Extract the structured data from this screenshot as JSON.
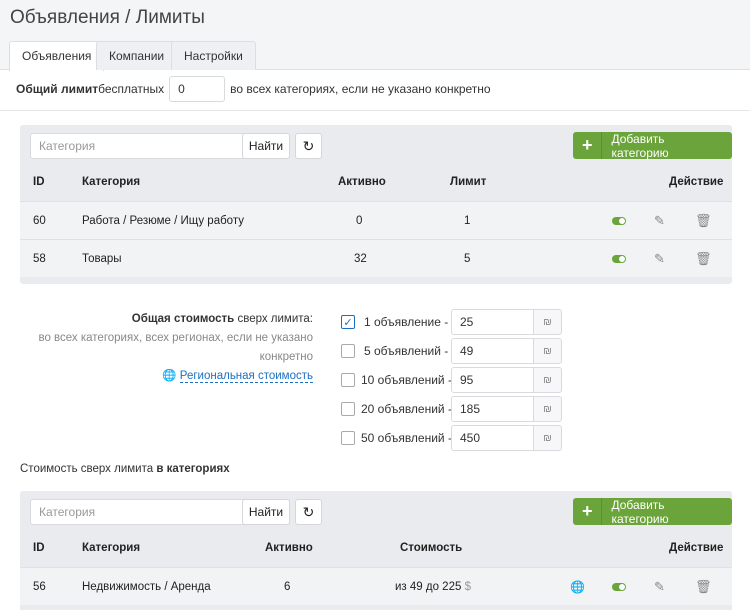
{
  "header": {
    "title": "Объявления / Лимиты"
  },
  "tabs": [
    {
      "label": "Объявления"
    },
    {
      "label": "Компании"
    },
    {
      "label": "Настройки"
    }
  ],
  "general_limit": {
    "bold": "Общий лимит",
    "text_before": " бесплатных",
    "value": "0",
    "text_after": "во всех категориях, если не указано конкретно"
  },
  "panel1": {
    "search_placeholder": "Категория",
    "find_label": "Найти",
    "add_label": "Добавить категорию",
    "headers": {
      "id": "ID",
      "category": "Категория",
      "active": "Активно",
      "limit": "Лимит",
      "action": "Действие"
    },
    "rows": [
      {
        "id": "60",
        "category": "Работа / Резюме / Ищу работу",
        "active": "0",
        "limit": "1"
      },
      {
        "id": "58",
        "category": "Товары",
        "active": "32",
        "limit": "5"
      }
    ]
  },
  "cost": {
    "bold": "Общая стоимость",
    "title_rest": " сверх лимита:",
    "desc1": "во всех категориях, всех регионах, если не указано",
    "desc2": "конкретно",
    "regional_link": "Региональная стоимость",
    "currency": "₪",
    "options": [
      {
        "label": "1 объявление -",
        "value": "25",
        "checked": true
      },
      {
        "label": "5 объявлений -",
        "value": "49",
        "checked": false
      },
      {
        "label": "10 объявлений -",
        "value": "95",
        "checked": false
      },
      {
        "label": "20 объявлений -",
        "value": "185",
        "checked": false
      },
      {
        "label": "50 объявлений -",
        "value": "450",
        "checked": false
      }
    ]
  },
  "category_cost_label": {
    "text": "Стоимость сверх лимита ",
    "bold": "в категориях"
  },
  "panel2": {
    "search_placeholder": "Категория",
    "find_label": "Найти",
    "add_label": "Добавить категорию",
    "headers": {
      "id": "ID",
      "category": "Категория",
      "active": "Активно",
      "cost": "Стоимость",
      "action": "Действие"
    },
    "rows": [
      {
        "id": "56",
        "category": "Недвижимость / Аренда",
        "active": "6",
        "cost": "из 49 до 225",
        "currency": "$"
      }
    ]
  },
  "colors": {
    "accent": "#6ba43a",
    "link": "#1c6fc0"
  }
}
